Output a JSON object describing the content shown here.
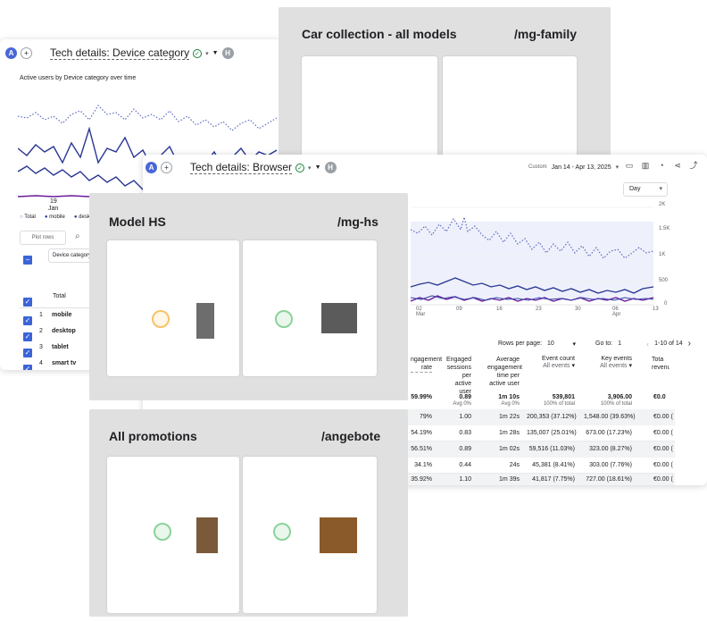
{
  "back_window": {
    "avatar_a": "A",
    "avatar_plus": "+",
    "title": "Tech details: Device category",
    "avatar_h": "H",
    "chart_title": "Active users by Device category over time",
    "x_tick_day": "19",
    "x_tick_month": "Jan",
    "legend": [
      "Total",
      "mobile",
      "desktop"
    ],
    "plot_rows_button": "Plot rows",
    "column_header": "Device category",
    "total_label": "Total",
    "rows": [
      {
        "index": "1",
        "label": "mobile"
      },
      {
        "index": "2",
        "label": "desktop"
      },
      {
        "index": "3",
        "label": "tablet"
      },
      {
        "index": "4",
        "label": "smart tv"
      }
    ]
  },
  "front_window": {
    "avatar_a": "A",
    "avatar_plus": "+",
    "title": "Tech details: Browser",
    "avatar_h": "H",
    "date_prefix": "Custom",
    "date_range": "Jan 14 - Apr 13, 2025",
    "granularity": "Day",
    "y_ticks": [
      "2K",
      "1.5K",
      "1K",
      "500",
      "0"
    ],
    "x_ticks": [
      {
        "day": "02",
        "month": "Mar"
      },
      {
        "day": "09",
        "month": ""
      },
      {
        "day": "16",
        "month": ""
      },
      {
        "day": "23",
        "month": ""
      },
      {
        "day": "30",
        "month": ""
      },
      {
        "day": "06",
        "month": "Apr"
      },
      {
        "day": "13",
        "month": ""
      }
    ],
    "pagination": {
      "rows_per_page_label": "Rows per page:",
      "rows_per_page_value": "10",
      "go_to_label": "Go to:",
      "go_to_value": "1",
      "range": "1-10 of 14"
    },
    "headers": {
      "engagement_rate": "ngagement rate",
      "engaged_sessions": "Engaged sessions per active user",
      "avg_engagement": "Average engagement time per active user",
      "event_count": "Event count",
      "event_count_sub": "All events",
      "key_events": "Key events",
      "key_events_sub": "All events",
      "revenue": "Tota revenu"
    },
    "totals": {
      "engagement_rate": "59.99%",
      "engaged_sessions": "0.89",
      "engaged_sessions_sub": "Avg 0%",
      "avg_engagement": "1m 10s",
      "avg_engagement_sub": "Avg 0%",
      "event_count": "539,801",
      "event_count_sub": "100% of total",
      "key_events": "3,906.00",
      "key_events_sub": "100% of total",
      "revenue": "€0.0"
    },
    "table_rows": [
      {
        "engagement_rate": "79%",
        "engaged_sessions": "1.00",
        "avg_engagement": "1m 22s",
        "event_count": "200,353 (37.12%)",
        "key_events": "1,548.00 (39.63%)",
        "revenue": "€0.00 ("
      },
      {
        "engagement_rate": "54.19%",
        "engaged_sessions": "0.83",
        "avg_engagement": "1m 28s",
        "event_count": "135,007 (25.01%)",
        "key_events": "673.00 (17.23%)",
        "revenue": "€0.00 ("
      },
      {
        "engagement_rate": "56.51%",
        "engaged_sessions": "0.89",
        "avg_engagement": "1m 02s",
        "event_count": "59,516 (11.03%)",
        "key_events": "323.00 (8.27%)",
        "revenue": "€0.00 ("
      },
      {
        "engagement_rate": "34.1%",
        "engaged_sessions": "0.44",
        "avg_engagement": "24s",
        "event_count": "45,381 (8.41%)",
        "key_events": "303.00 (7.76%)",
        "revenue": "€0.00 ("
      },
      {
        "engagement_rate": "35.92%",
        "engaged_sessions": "1.10",
        "avg_engagement": "1m 39s",
        "event_count": "41,817 (7.75%)",
        "key_events": "727.00 (18.61%)",
        "revenue": "€0.00 ("
      }
    ]
  },
  "cards": {
    "car_collection": {
      "title": "Car collection - all models",
      "path": "/mg-family"
    },
    "model_hs": {
      "title": "Model HS",
      "path": "/mg-hs"
    },
    "all_promotions": {
      "title": "All promotions",
      "path": "/angebote"
    }
  },
  "colors": {
    "accent": "#3b64d8",
    "line_dark": "#283593",
    "line_purple": "#6a1b9a",
    "card_bg": "#e0e0e0",
    "check_green": "#188038"
  }
}
